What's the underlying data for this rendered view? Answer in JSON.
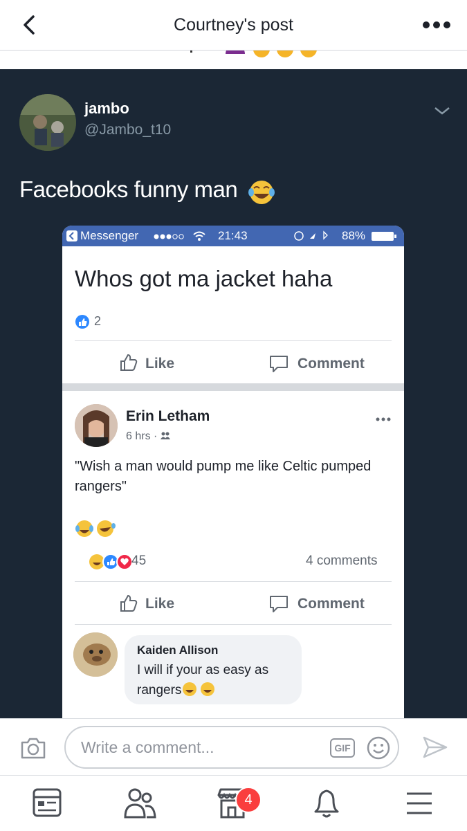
{
  "header": {
    "title": "Courtney's post"
  },
  "tweet": {
    "name": "jambo",
    "handle": "@Jambo_t10",
    "text": "Facebooks funny man"
  },
  "screenshot": {
    "status": {
      "app": "Messenger",
      "time": "21:43",
      "battery": "88%"
    },
    "post_text": "Whos got ma jacket haha",
    "like_count": "2",
    "like_label": "Like",
    "comment_label": "Comment",
    "comment_post": {
      "author": "Erin Letham",
      "time": "6 hrs",
      "text": "\"Wish a man would pump me like Celtic pumped rangers\"",
      "reaction_count": "45",
      "comments_count": "4 comments"
    },
    "reply": {
      "author": "Kaiden Allison",
      "text": "I will if your as easy as rangers"
    }
  },
  "composer": {
    "placeholder": "Write a comment...",
    "gif_label": "GIF"
  },
  "tabbar": {
    "badge": "4"
  },
  "colors": {
    "tweet_bg": "#1b2735",
    "fb_blue": "#4267b2",
    "badge_red": "#fa3e3e"
  }
}
